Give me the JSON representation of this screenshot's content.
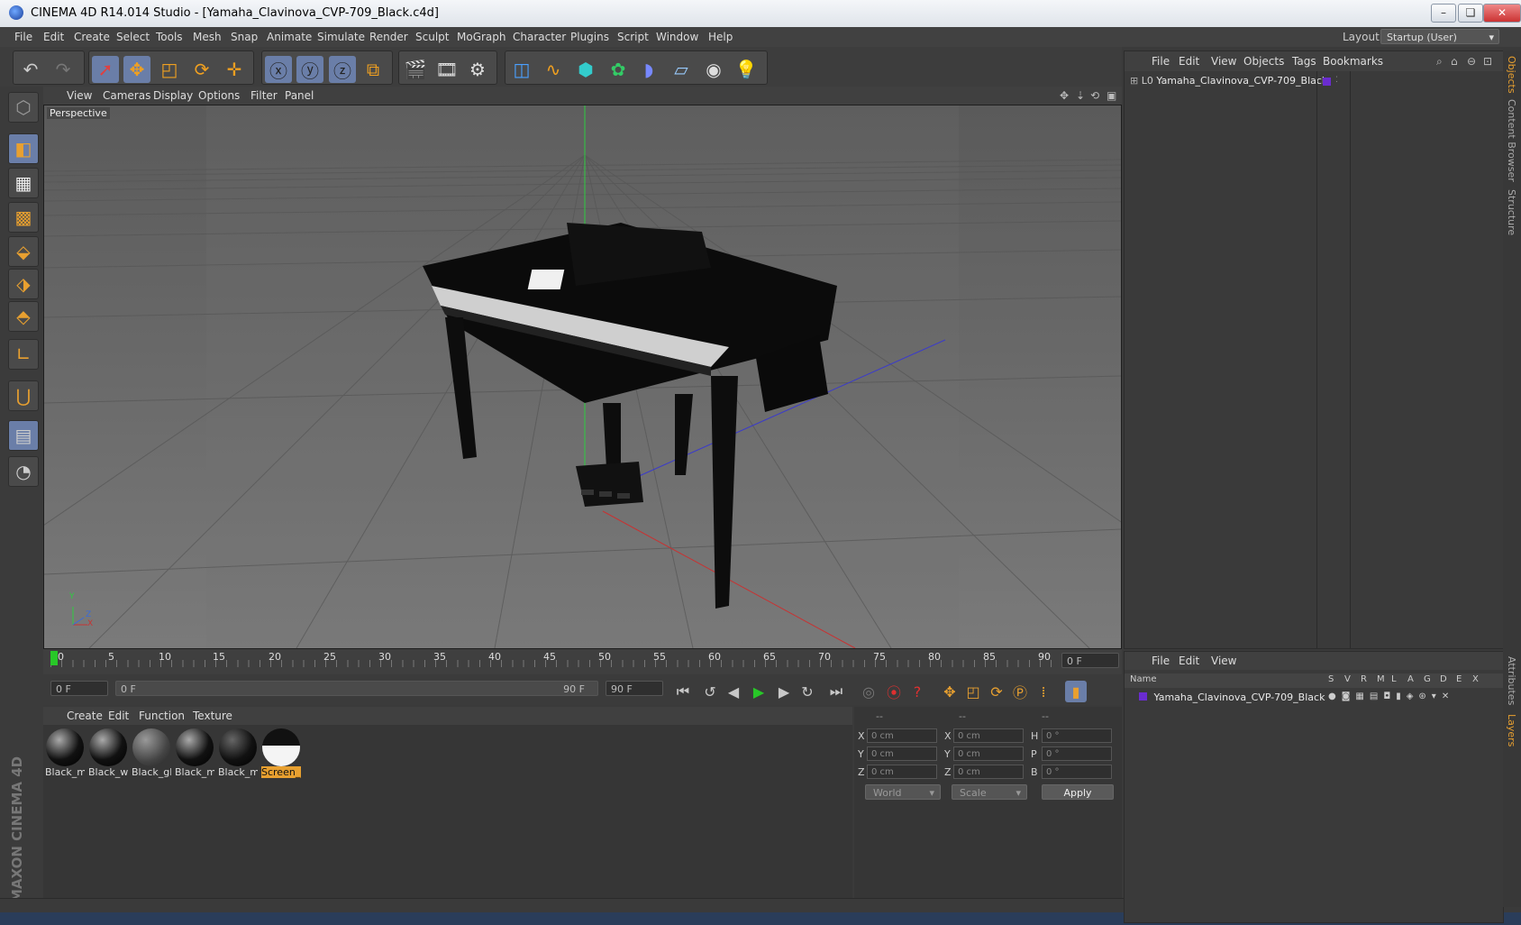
{
  "window": {
    "title": "CINEMA 4D R14.014 Studio - [Yamaha_Clavinova_CVP-709_Black.c4d]",
    "min": "–",
    "restore": "❏",
    "close": "✕"
  },
  "menu": [
    "File",
    "Edit",
    "Create",
    "Select",
    "Tools",
    "Mesh",
    "Snap",
    "Animate",
    "Simulate",
    "Render",
    "Sculpt",
    "MoGraph",
    "Character",
    "Plugins",
    "Script",
    "Window",
    "Help"
  ],
  "layout": {
    "label": "Layout:",
    "value": "Startup (User)"
  },
  "viewport": {
    "menu": [
      "View",
      "Cameras",
      "Display",
      "Options",
      "Filter",
      "Panel"
    ],
    "label": "Perspective",
    "axis": {
      "x": "X",
      "y": "Y",
      "z": "Z"
    }
  },
  "timeline": {
    "ticks": [
      "0",
      "5",
      "10",
      "15",
      "20",
      "25",
      "30",
      "35",
      "40",
      "45",
      "50",
      "55",
      "60",
      "65",
      "70",
      "75",
      "80",
      "85",
      "90"
    ],
    "current_frame": "0 F",
    "start_field": "0 F",
    "range_start": "0 F",
    "range_end": "90 F",
    "end_field": "90 F"
  },
  "materials": {
    "menu": [
      "Create",
      "Edit",
      "Function",
      "Texture"
    ],
    "items": [
      {
        "label": "Black_m"
      },
      {
        "label": "Black_w"
      },
      {
        "label": "Black_gl"
      },
      {
        "label": "Black_m"
      },
      {
        "label": "Black_m"
      },
      {
        "label": "Screen_l"
      }
    ]
  },
  "coordinates": {
    "headers": [
      "--",
      "--",
      "--"
    ],
    "rows": [
      {
        "a": "X",
        "av": "0 cm",
        "b": "X",
        "bv": "0 cm",
        "c": "H",
        "cv": "0 °"
      },
      {
        "a": "Y",
        "av": "0 cm",
        "b": "Y",
        "bv": "0 cm",
        "c": "P",
        "cv": "0 °"
      },
      {
        "a": "Z",
        "av": "0 cm",
        "b": "Z",
        "bv": "0 cm",
        "c": "B",
        "cv": "0 °"
      }
    ],
    "world": "World",
    "scale": "Scale",
    "apply": "Apply"
  },
  "objects": {
    "menu": [
      "File",
      "Edit",
      "View",
      "Objects",
      "Tags",
      "Bookmarks"
    ],
    "tree": [
      {
        "name": "Yamaha_Clavinova_CVP-709_Black",
        "color": "#6a2ccf"
      }
    ]
  },
  "layers": {
    "menu": [
      "File",
      "Edit",
      "View"
    ],
    "header": {
      "name": "Name",
      "cols": [
        "S",
        "V",
        "R",
        "M",
        "L",
        "A",
        "G",
        "D",
        "E",
        "X"
      ]
    },
    "rows": [
      {
        "name": "Yamaha_Clavinova_CVP-709_Black",
        "color": "#6a2ccf"
      }
    ]
  },
  "right_tabs": [
    "Objects",
    "Content Browser",
    "Structure",
    "Attributes",
    "Layers"
  ],
  "brand": {
    "logo": "MAXON CINEMA 4D"
  },
  "colors": {
    "accent": "#e8a030",
    "selection": "#6a7ea8",
    "object_color": "#6a2ccf",
    "play": "#28c828"
  }
}
